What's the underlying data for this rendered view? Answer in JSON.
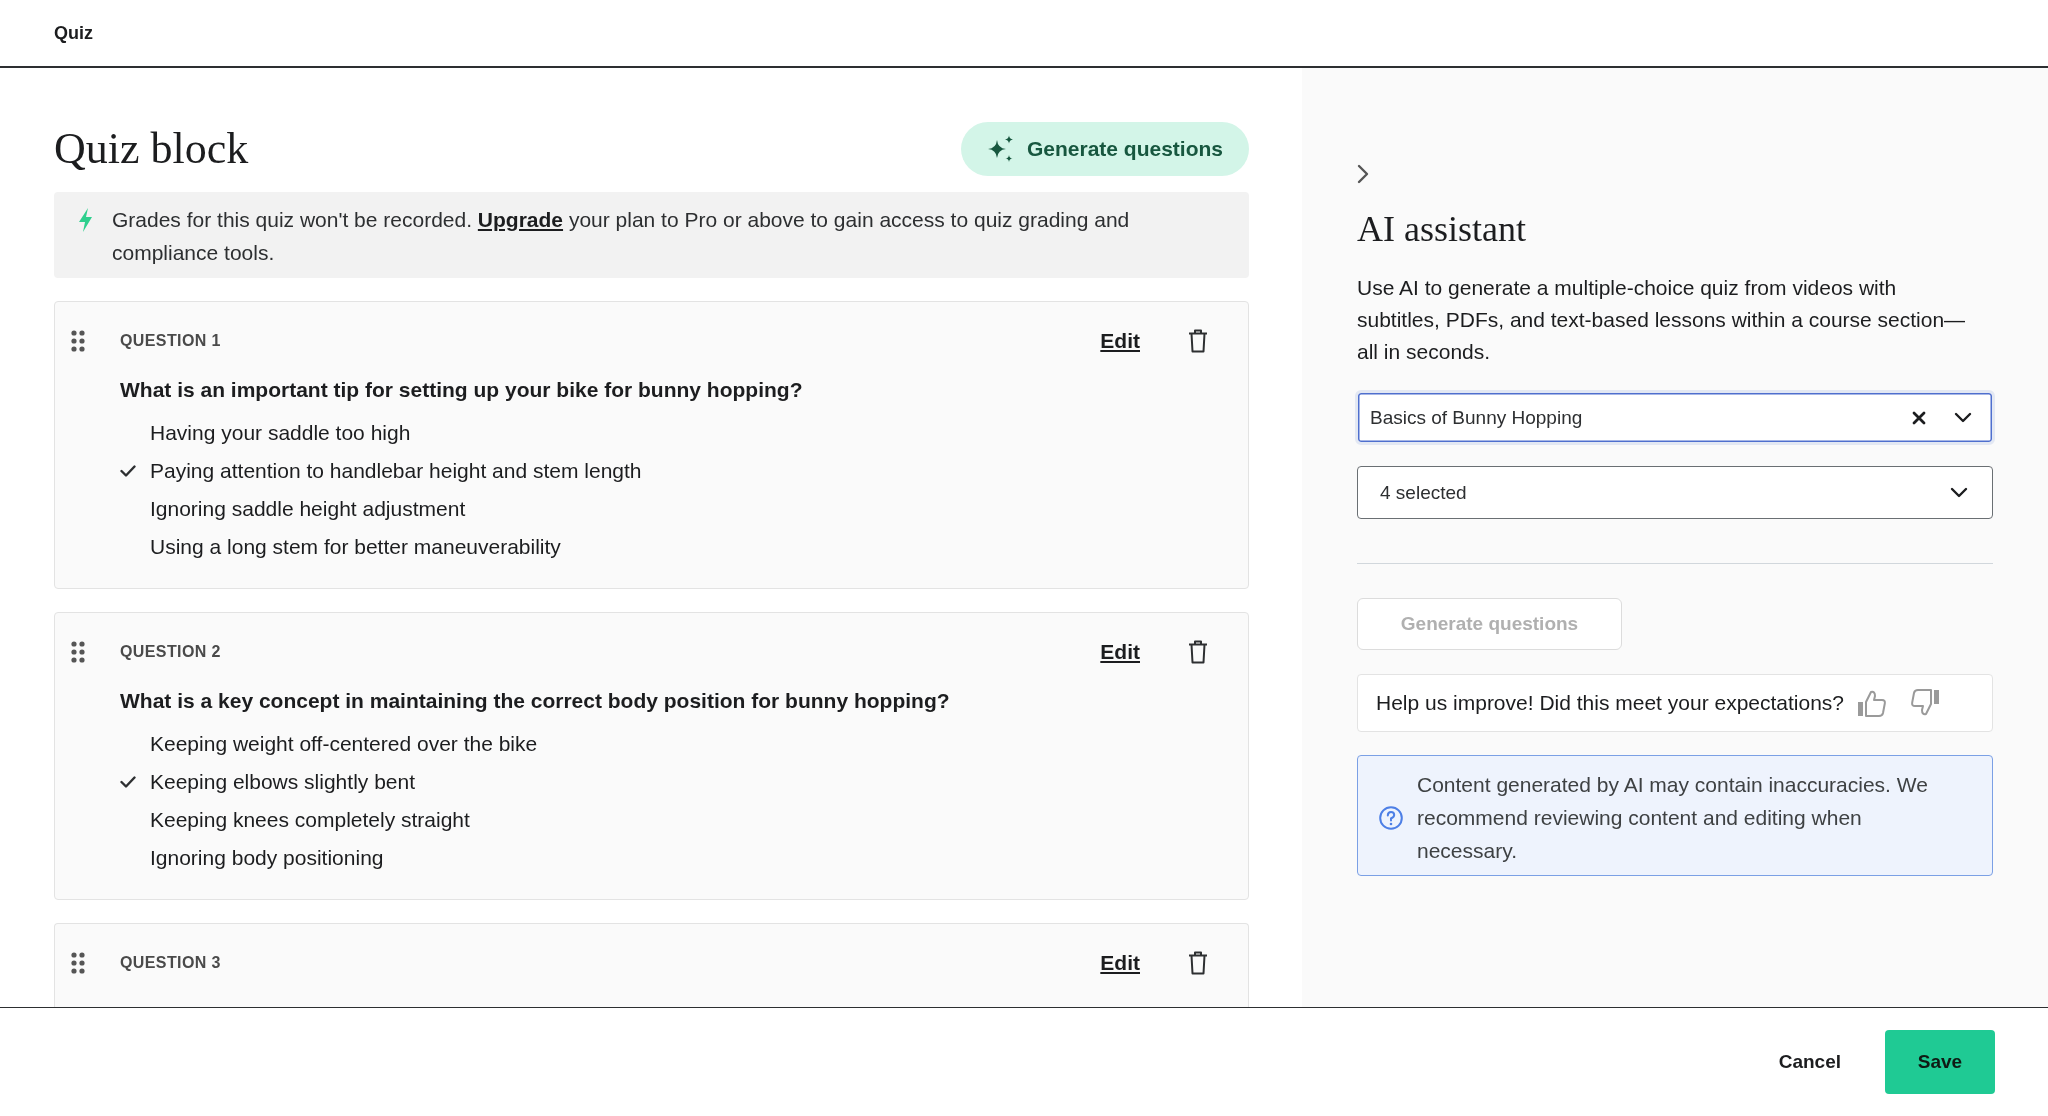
{
  "top_bar": {
    "title": "Quiz"
  },
  "quiz_block": {
    "title": "Quiz block",
    "generate_button": "Generate questions",
    "notice": {
      "before": "Grades for this quiz won't be recorded.",
      "link": "Upgrade",
      "after": "your plan to Pro or above to gain access to quiz grading and compliance tools."
    }
  },
  "questions": [
    {
      "label": "QUESTION 1",
      "edit": "Edit",
      "prompt": "What is an important tip for setting up your bike for bunny hopping?",
      "answers": [
        {
          "text": "Having your saddle too high",
          "correct": false
        },
        {
          "text": "Paying attention to handlebar height and stem length",
          "correct": true
        },
        {
          "text": "Ignoring saddle height adjustment",
          "correct": false
        },
        {
          "text": "Using a long stem for better maneuverability",
          "correct": false
        }
      ]
    },
    {
      "label": "QUESTION 2",
      "edit": "Edit",
      "prompt": "What is a key concept in maintaining the correct body position for bunny hopping?",
      "answers": [
        {
          "text": "Keeping weight off-centered over the bike",
          "correct": false
        },
        {
          "text": "Keeping elbows slightly bent",
          "correct": true
        },
        {
          "text": "Keeping knees completely straight",
          "correct": false
        },
        {
          "text": "Ignoring body positioning",
          "correct": false
        }
      ]
    },
    {
      "label": "QUESTION 3",
      "edit": "Edit"
    }
  ],
  "ai_panel": {
    "title": "AI assistant",
    "description": "Use AI to generate a multiple-choice quiz from videos with subtitles, PDFs, and text-based lessons within a course section—all in seconds.",
    "section_select": {
      "value": "Basics of Bunny Hopping",
      "focused": true,
      "clear_button": true
    },
    "lesson_select": {
      "value": "4 selected",
      "focused": false,
      "clear_button": false
    },
    "generate_button": {
      "label": "Generate questions",
      "disabled": true
    },
    "feedback": {
      "text": "Help us improve! Did this meet your expectations?"
    },
    "disclaimer": "Content generated by AI may contain inaccuracies. We recommend reviewing content and editing when necessary."
  },
  "footer": {
    "cancel_button": "Cancel",
    "save_button": "Save"
  }
}
